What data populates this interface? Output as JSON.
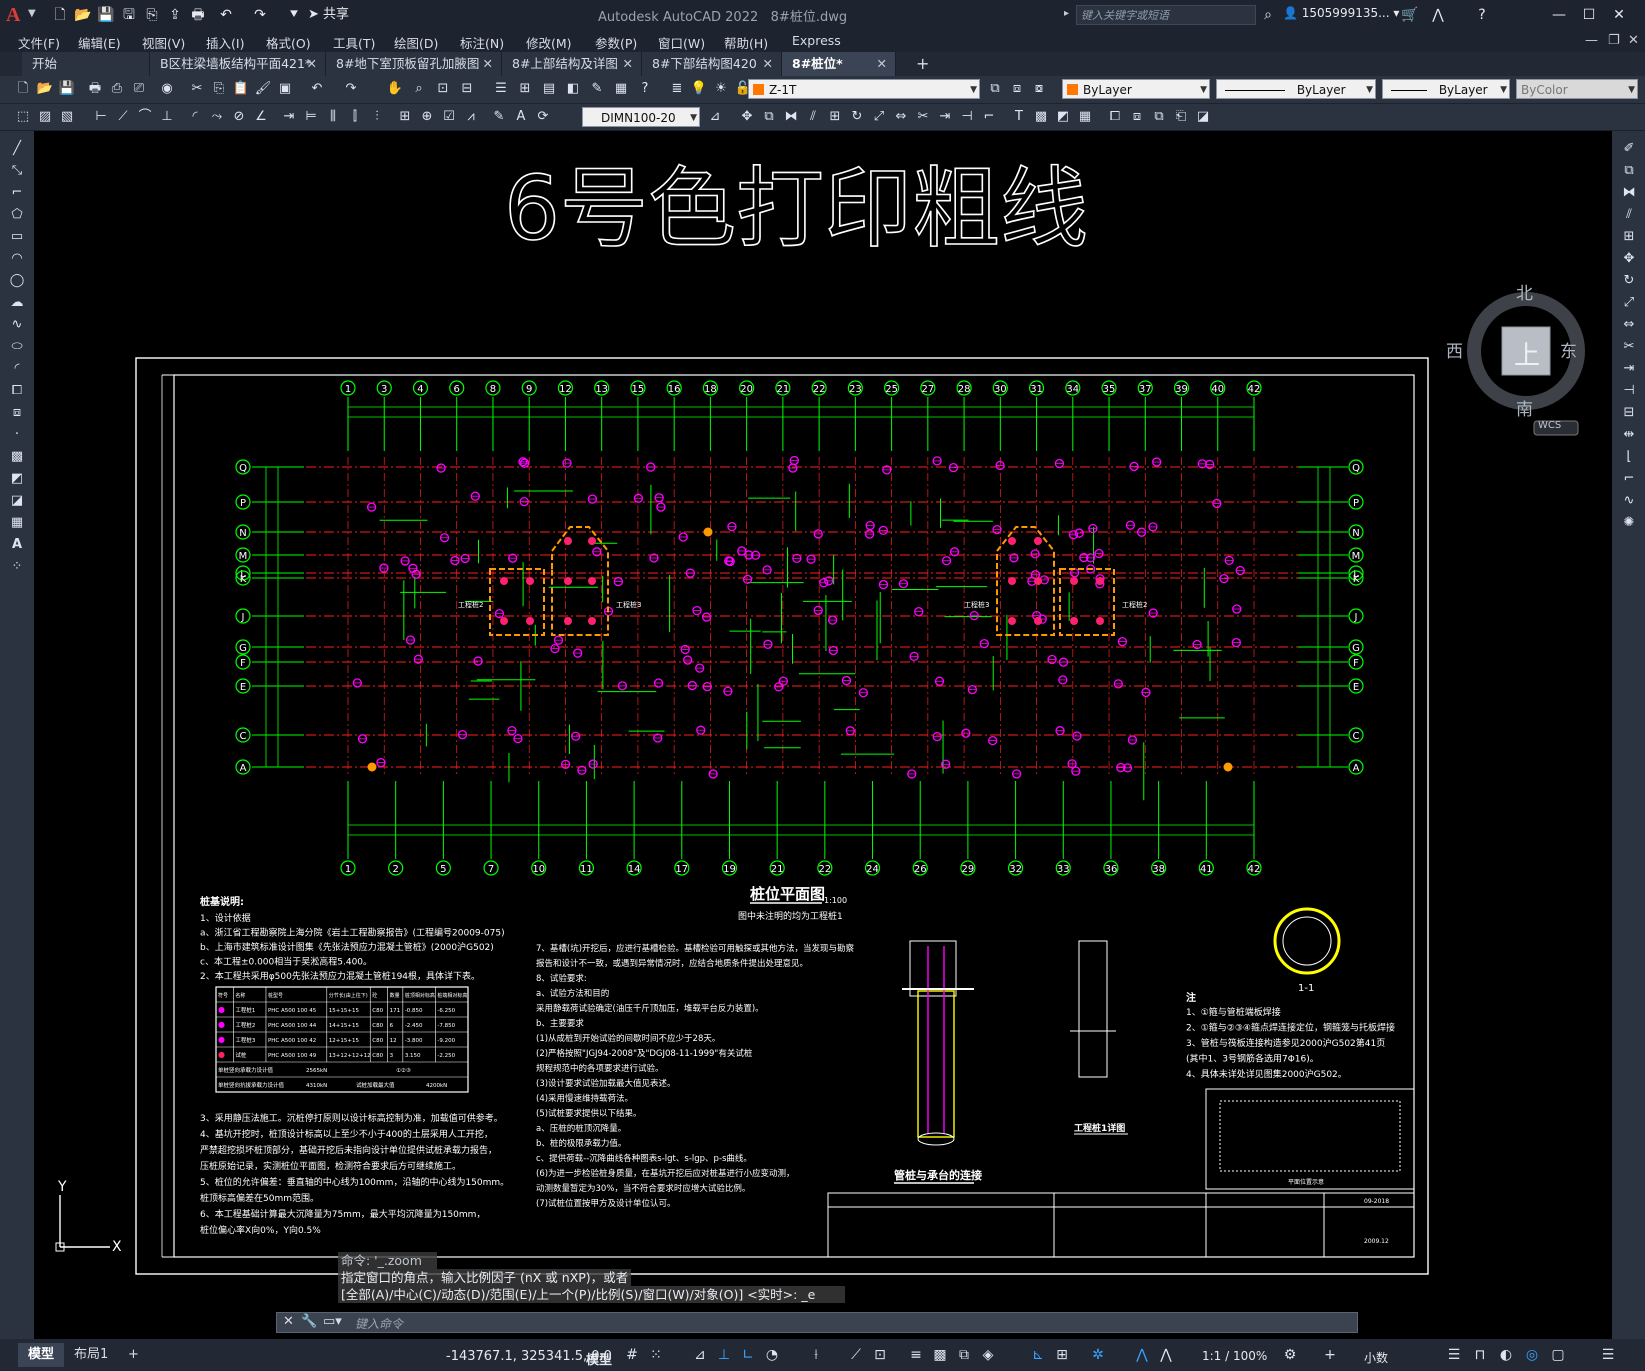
{
  "app": {
    "title": "Autodesk AutoCAD 2022",
    "document": "8#桩位.dwg",
    "search_placeholder": "键入关键字或短语",
    "user": "1505999135...",
    "share_label": "共享",
    "logo_letter": "A"
  },
  "menu": [
    "文件(F)",
    "编辑(E)",
    "视图(V)",
    "插入(I)",
    "格式(O)",
    "工具(T)",
    "绘图(D)",
    "标注(N)",
    "修改(M)",
    "参数(P)",
    "窗口(W)",
    "帮助(H)",
    "Express"
  ],
  "tabs": [
    {
      "label": "开始",
      "active": false
    },
    {
      "label": "B区柱梁墙板结构平面421*",
      "active": false
    },
    {
      "label": "8#地下室顶板留孔加腋图",
      "active": false
    },
    {
      "label": "8#上部结构及详图",
      "active": false
    },
    {
      "label": "8#下部结构图420",
      "active": false
    },
    {
      "label": "8#桩位*",
      "active": true
    }
  ],
  "toolbar": {
    "layer_name": "Z-1T",
    "color": "ByLayer",
    "linetype": "ByLayer",
    "lineweight": "ByLayer",
    "plotstyle": "ByColor",
    "dimstyle": "DIMN100-20"
  },
  "viewcube": {
    "north": "北",
    "south": "南",
    "east": "东",
    "west": "西",
    "top": "上",
    "wcs": "WCS"
  },
  "drawing": {
    "banner": "6号色打印粗线",
    "plan_title": "桩位平面图",
    "plan_scale": "1:100",
    "plan_subtitle": "图中未注明的均为工程桩1",
    "top_axes": [
      "1",
      "3",
      "4",
      "6",
      "8",
      "9",
      "12",
      "13",
      "15",
      "16",
      "18",
      "20",
      "21",
      "22",
      "23",
      "25",
      "27",
      "28",
      "30",
      "31",
      "34",
      "35",
      "37",
      "39",
      "40",
      "42"
    ],
    "bottom_axes": [
      "1",
      "2",
      "5",
      "7",
      "10",
      "11",
      "14",
      "17",
      "19",
      "21",
      "22",
      "24",
      "26",
      "29",
      "32",
      "33",
      "36",
      "38",
      "41",
      "42"
    ],
    "row_axes": [
      "Q",
      "P",
      "N",
      "M",
      "L",
      "K",
      "J",
      "G",
      "F",
      "E",
      "C",
      "A"
    ],
    "notes_title": "桩基说明:",
    "notes_left": [
      "1、设计依据",
      "a、浙江省工程勘察院上海分院《岩土工程勘察报告》(工程编号20009-075)",
      "b、上海市建筑标准设计图集《先张法预应力混凝土管桩》(2000沪G502)",
      "c、本工程±0.000相当于吴淞高程5.400。",
      "2、本工程共采用φ500先张法预应力混凝土管桩194根，具体详下表。"
    ],
    "notes_left2": [
      "3、采用静压法施工。沉桩停打原则以设计标高控制为准，加载值可供参考。",
      "4、基坑开挖时，桩顶设计标高以上至少不小于400的土层采用人工开挖，",
      "严禁超挖损坏桩顶部分，基础开挖后未指向设计单位提供试桩承载力报告，",
      "压桩原始记录，实测桩位平面图，检测符合要求后方可继续施工。",
      "5、桩位的允许偏差：垂直轴的中心线为100mm，沿轴的中心线为150mm。",
      "桩顶标高偏差在50mm范围。",
      "6、本工程基础计算最大沉降量为75mm，最大平均沉降量为150mm，",
      "桩位偏心率X向0%，Y向0.5%"
    ],
    "notes_mid": [
      "7、基槽(坑)开挖后，应进行基槽检验。基槽检验可用触探或其他方法，当发现与勘察",
      "报告和设计不一致，或遇到异常情况时，应结合地质条件提出处理意见。",
      "8、试验要求:",
      "a、试验方法和目的",
      "采用静载荷试验确定(油压千斤顶加压，堆载平台反力装置)。",
      "b、主要要求",
      "(1)从成桩到开始试验的间歇时间不应少于28天。",
      "(2)严格按照\"JGJ94-2008\"及\"DGJ08-11-1999\"有关试桩",
      "规程规范中的各项要求进行试验。",
      "(3)设计要求试验加载最大值见表述。",
      "(4)采用慢速维持载荷法。",
      "(5)试桩要求提供以下结果。",
      "a、压桩的桩顶沉降量。",
      "b、桩的极限承载力值。",
      "c、提供荷载--沉降曲线各种图表s-lgt、s-lgp、p-s曲线。",
      "(6)为进一步检验桩身质量，在基坑开挖后应对桩基进行小应变动测，",
      "动测数量暂定为30%，当不符合要求时应增大试验比例。",
      "(7)试桩位置按甲方及设计单位认可。"
    ],
    "notes_right_title": "注",
    "notes_right": [
      "1、①箍与管桩端板焊接",
      "2、①箍与②③④箍点焊连接定位，钢箍笼与托板焊接",
      "3、管桩与筏板连接构造参见2000沪G502第41页",
      "(其中1、3号钢筋各选用7Φ16)。",
      "4、具体未详处详见图集2000沪G502。"
    ],
    "pile_table": {
      "headers": [
        "符号",
        "名称",
        "桩型号",
        "分节长(由上往下)",
        "砼",
        "数量",
        "桩顶相对标高",
        "桩端相对标高"
      ],
      "rows": [
        [
          "●",
          "工程桩1",
          "PHC A500 100 45",
          "15+15+15",
          "C80",
          "171",
          "-0.850",
          "-6.250"
        ],
        [
          "●",
          "工程桩2",
          "PHC A500 100 44",
          "14+15+15",
          "C80",
          "6",
          "-2.450",
          "-7.850"
        ],
        [
          "●",
          "工程桩3",
          "PHC A500 100 42",
          "12+15+15",
          "C80",
          "12",
          "-3.800",
          "-9.200"
        ],
        [
          "●",
          "试桩",
          "PHC A500 100 49",
          "13+12+12+12",
          "C80",
          "3",
          "3.150",
          "-2.250"
        ]
      ],
      "footer": [
        [
          "单桩竖向承载力设计值",
          "2565kN",
          "①②③"
        ],
        [
          "单桩竖向抗拔承载力设计值",
          "4310kN",
          "试桩加载最大值",
          "4200kN"
        ]
      ]
    },
    "detail_titles": {
      "connection": "管桩与承台的连接",
      "pile_detail": "工程桩1详图",
      "section": "1-1",
      "site_plan": "平面位置示意"
    },
    "labels": {
      "pile2": "工程桩2",
      "pile3": "工程桩3",
      "sign_date": "2009.12",
      "drawing_no": "09-2018"
    }
  },
  "command": {
    "history": [
      "命令: '_.zoom",
      "指定窗口的角点，输入比例因子 (nX 或 nXP)，或者",
      "[全部(A)/中心(C)/动态(D)/范围(E)/上一个(P)/比例(S)/窗口(W)/对象(O)] <实时>: _e"
    ],
    "placeholder": "键入命令"
  },
  "status": {
    "model_tab": "模型",
    "layout_tab": "布局1",
    "add_tab": "+",
    "coords": "-143767.1, 325341.5, 0.0",
    "space": "模型",
    "scale": "1:1 / 100%",
    "units": "小数"
  },
  "colors": {
    "axis_green": "#00ff00",
    "pile_magenta": "#ff00ff",
    "axis_red": "#ff2020",
    "highlight_orange": "#ff9900",
    "dim_text": "#ffff40"
  }
}
